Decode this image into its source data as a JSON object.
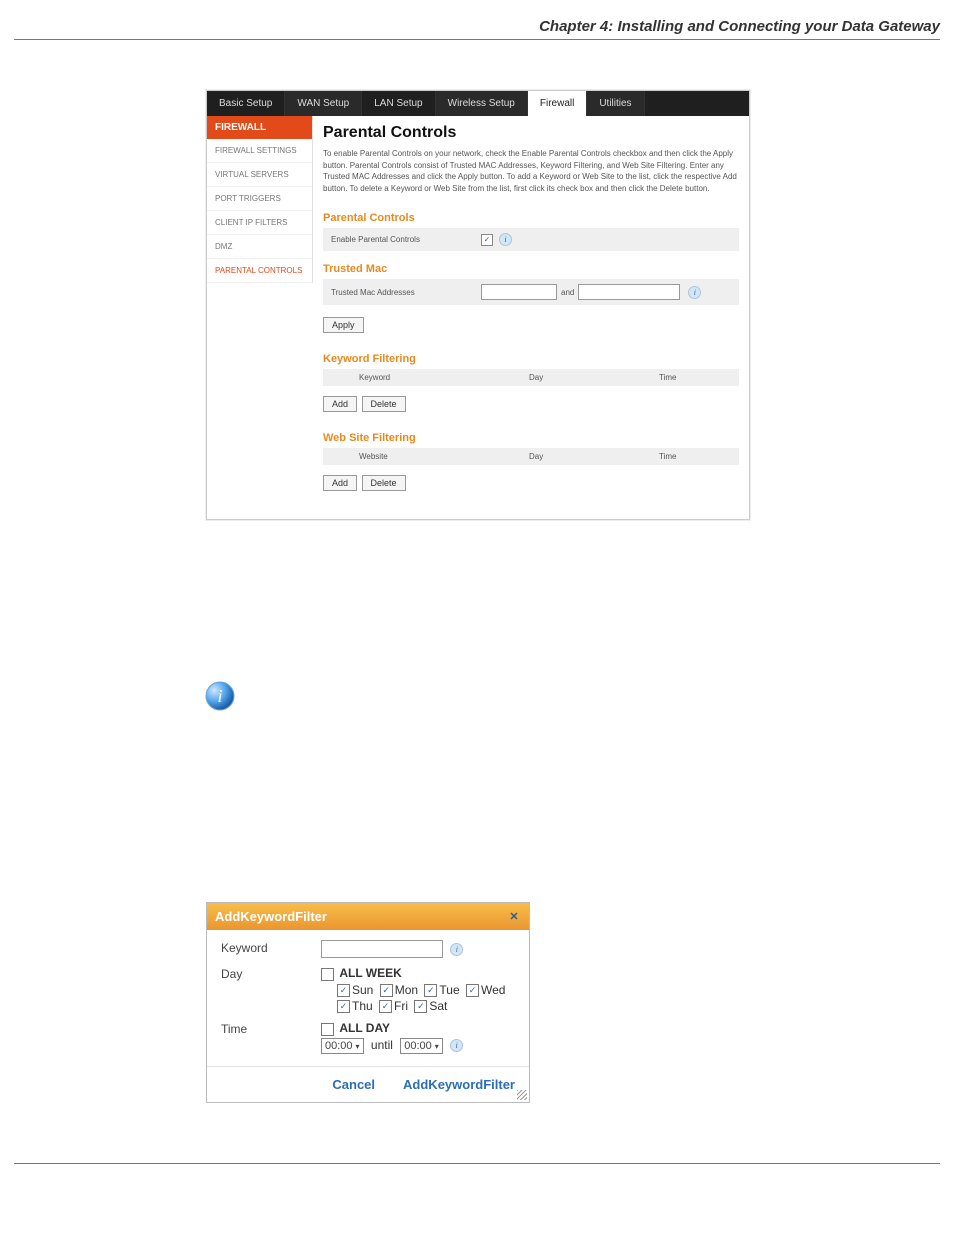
{
  "chapter": {
    "title": "Chapter 4: Installing and Connecting your Data Gateway"
  },
  "screenshot": {
    "tabs": [
      "Basic Setup",
      "WAN Setup",
      "LAN Setup",
      "Wireless Setup",
      "Firewall",
      "Utilities"
    ],
    "active_tab": 4,
    "sidebar": {
      "header": "FIREWALL",
      "items": [
        "FIREWALL SETTINGS",
        "VIRTUAL SERVERS",
        "PORT TRIGGERS",
        "CLIENT IP FILTERS",
        "DMZ",
        "PARENTAL CONTROLS"
      ],
      "active_index": 5
    },
    "main": {
      "title": "Parental Controls",
      "description": "To enable Parental Controls on your network, check the Enable Parental Controls checkbox and then click the Apply button. Parental Controls consist of Trusted MAC Addresses, Keyword Filtering, and Web Site Filtering. Enter any Trusted MAC Addresses and click the Apply button. To add a Keyword or Web Site to the list, click the respective Add button. To delete a Keyword or Web Site from the list, first click its check box and then click the Delete button.",
      "sections": {
        "parental": {
          "heading": "Parental Controls",
          "enable_label": "Enable Parental Controls",
          "enable_checked": true
        },
        "trusted": {
          "heading": "Trusted Mac",
          "label": "Trusted Mac Addresses",
          "and": "and",
          "apply": "Apply"
        },
        "keyword": {
          "heading": "Keyword Filtering",
          "cols": {
            "c1": "Keyword",
            "c2": "Day",
            "c3": "Time"
          },
          "add": "Add",
          "delete": "Delete"
        },
        "website": {
          "heading": "Web Site Filtering",
          "cols": {
            "c1": "Website",
            "c2": "Day",
            "c3": "Time"
          },
          "add": "Add",
          "delete": "Delete"
        }
      }
    }
  },
  "dialog": {
    "title": "AddKeywordFilter",
    "labels": {
      "keyword": "Keyword",
      "day": "Day",
      "time": "Time"
    },
    "allweek": "ALL WEEK",
    "allday": "ALL DAY",
    "days": {
      "sun": "Sun",
      "mon": "Mon",
      "tue": "Tue",
      "wed": "Wed",
      "thu": "Thu",
      "fri": "Fri",
      "sat": "Sat"
    },
    "time_from": "00:00",
    "until": "until",
    "time_to": "00:00",
    "cancel": "Cancel",
    "submit": "AddKeywordFilter"
  }
}
